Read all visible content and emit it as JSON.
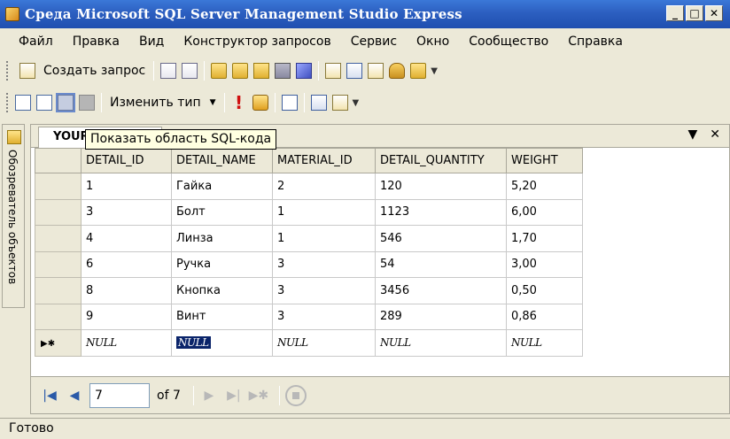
{
  "window": {
    "title": "Среда Microsoft SQL Server Management Studio Express"
  },
  "menu": [
    "Файл",
    "Правка",
    "Вид",
    "Конструктор запросов",
    "Сервис",
    "Окно",
    "Сообщество",
    "Справка"
  ],
  "toolbar1": {
    "new_query_label": "Создать запрос"
  },
  "toolbar2": {
    "change_type_label": "Изменить тип"
  },
  "side_panel": {
    "label": "Обозреватель объектов"
  },
  "tab": {
    "label": "YOUR"
  },
  "tooltip": {
    "text": "Показать область SQL-кода"
  },
  "grid": {
    "columns": [
      "DETAIL_ID",
      "DETAIL_NAME",
      "MATERIAL_ID",
      "DETAIL_QUANTITY",
      "WEIGHT"
    ],
    "rows": [
      [
        "1",
        "Гайка",
        "2",
        "120",
        "5,20"
      ],
      [
        "3",
        "Болт",
        "1",
        "1123",
        "6,00"
      ],
      [
        "4",
        "Линза",
        "1",
        "546",
        "1,70"
      ],
      [
        "6",
        "Ручка",
        "3",
        "54",
        "3,00"
      ],
      [
        "8",
        "Кнопка",
        "3",
        "3456",
        "0,50"
      ],
      [
        "9",
        "Винт",
        "3",
        "289",
        "0,86"
      ]
    ],
    "null_text": "NULL"
  },
  "navigation": {
    "current_record": "7",
    "of_label": "of 7"
  },
  "status": {
    "text": "Готово"
  }
}
